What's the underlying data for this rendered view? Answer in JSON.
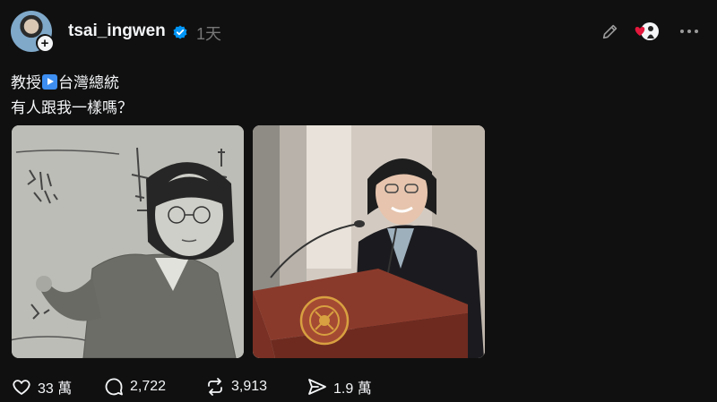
{
  "header": {
    "username": "tsai_ingwen",
    "time": "1天"
  },
  "post": {
    "line1_prefix": "教授",
    "line1_suffix": "台灣總統",
    "line2": "有人跟我一樣嗎？"
  },
  "actions": {
    "likes": "33 萬",
    "replies": "2,722",
    "reposts": "3,913",
    "shares": "1.9 萬"
  },
  "colors": {
    "background": "#101010",
    "text": "#f3f5f7",
    "muted": "#777777",
    "verified": "#0095f6",
    "heart": "#e4183c"
  }
}
